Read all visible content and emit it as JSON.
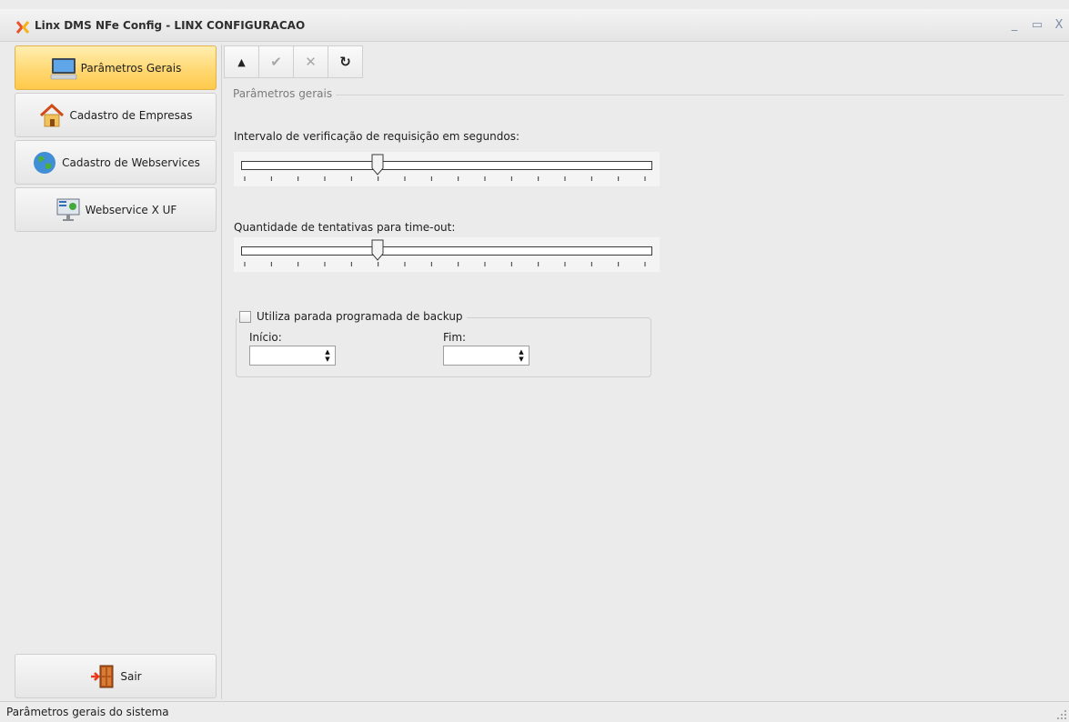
{
  "window": {
    "title": "Linx DMS NFe Config - LINX CONFIGURACAO",
    "minimize_glyph": "_",
    "maximize_glyph": "▭",
    "close_glyph": "X"
  },
  "sidebar": {
    "items": [
      {
        "label": "Parâmetros Gerais",
        "icon": "computer-icon",
        "active": true
      },
      {
        "label": "Cadastro de Empresas",
        "icon": "house-icon",
        "active": false
      },
      {
        "label": "Cadastro de Webservices",
        "icon": "globe-icon",
        "active": false
      },
      {
        "label": "Webservice X UF",
        "icon": "monitor-icon",
        "active": false
      }
    ],
    "exit_label": "Sair",
    "exit_icon": "exit-door-icon"
  },
  "toolbar": {
    "buttons": [
      {
        "name": "up-arrow-icon",
        "glyph": "▲",
        "enabled": true
      },
      {
        "name": "confirm-check-icon",
        "glyph": "✔",
        "enabled": false
      },
      {
        "name": "cancel-x-icon",
        "glyph": "✕",
        "enabled": false
      },
      {
        "name": "refresh-icon",
        "glyph": "↻",
        "enabled": true
      }
    ]
  },
  "params": {
    "group_title": "Parâmetros gerais",
    "interval_label": "Intervalo de verificação de requisição em segundos:",
    "interval_slider_fraction": 0.33,
    "timeout_label": "Quantidade de tentativas para time-out:",
    "timeout_slider_fraction": 0.33,
    "backup": {
      "checkbox_label": "Utiliza parada programada de backup",
      "checked": false,
      "start_label": "Início:",
      "start_value": "",
      "end_label": "Fim:",
      "end_value": ""
    }
  },
  "statusbar": {
    "text": "Parâmetros gerais do sistema"
  },
  "colors": {
    "active_nav": "#ffd873",
    "window_bg": "#ebebeb"
  }
}
